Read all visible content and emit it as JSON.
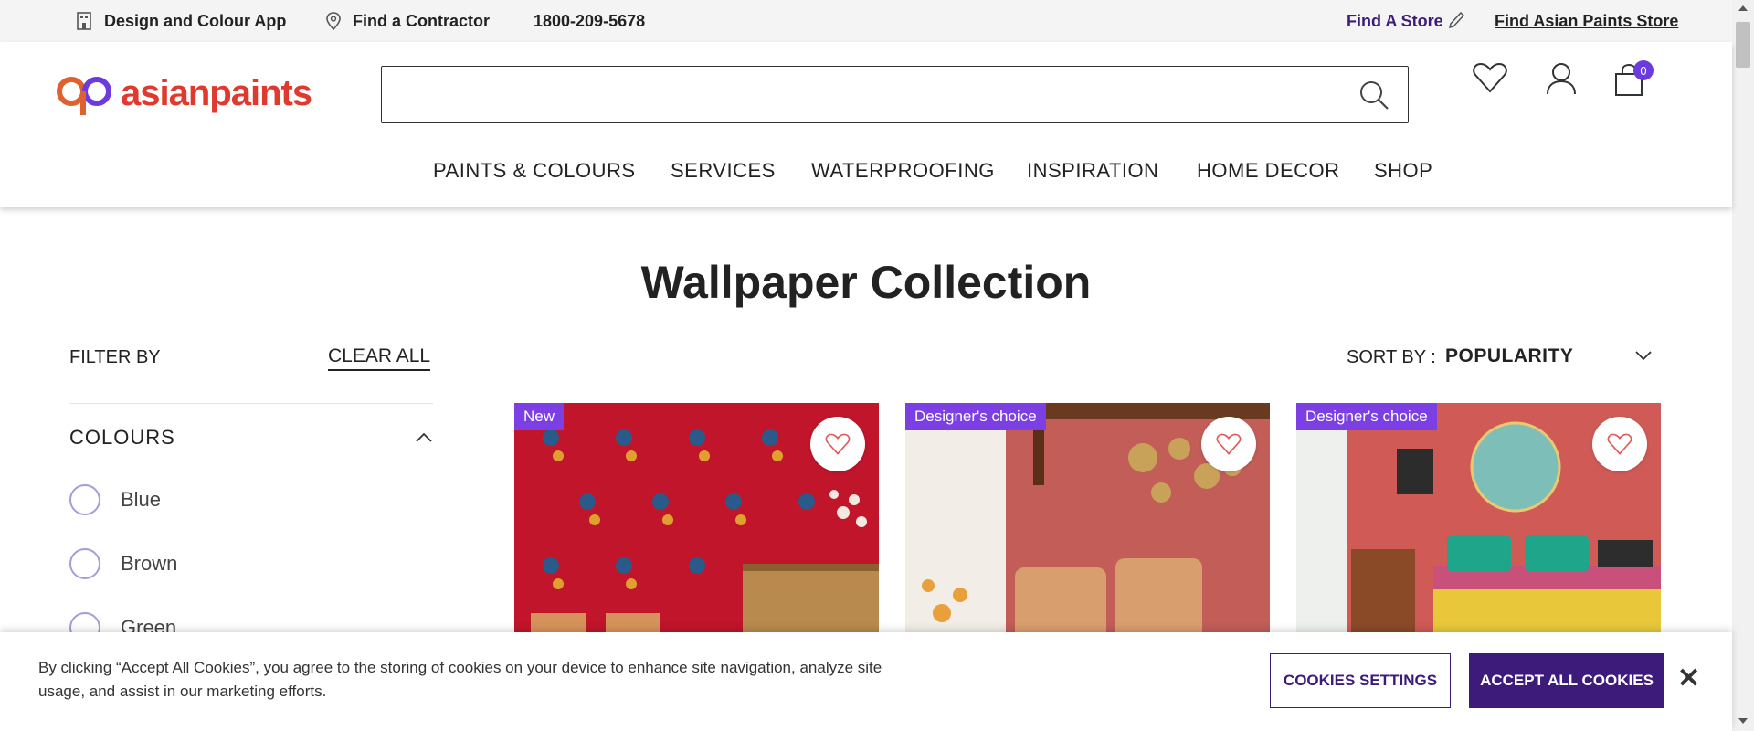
{
  "topbar": {
    "design_app": "Design and Colour App",
    "find_contractor": "Find a Contractor",
    "phone": "1800-209-5678",
    "find_store": "Find A Store",
    "find_asian_store": "Find Asian Paints Store"
  },
  "header": {
    "logo_text": "asianpaints",
    "search_placeholder": "",
    "cart_count": "0"
  },
  "nav": [
    {
      "label": "PAINTS & COLOURS"
    },
    {
      "label": "SERVICES"
    },
    {
      "label": "WATERPROOFING"
    },
    {
      "label": "INSPIRATION"
    },
    {
      "label": "HOME DECOR"
    },
    {
      "label": "SHOP"
    }
  ],
  "page": {
    "title": "Wallpaper Collection"
  },
  "filter": {
    "label": "FILTER BY",
    "clear_all": "CLEAR ALL",
    "section_title": "COLOURS",
    "options": [
      "Blue",
      "Brown",
      "Green"
    ]
  },
  "sort": {
    "label": "SORT BY :",
    "value": "POPULARITY"
  },
  "products": [
    {
      "tag": "New"
    },
    {
      "tag": "Designer's choice"
    },
    {
      "tag": "Designer's choice"
    }
  ],
  "cookie": {
    "text": "By clicking “Accept All Cookies”, you agree to the storing of cookies on your device to enhance site navigation, analyze site usage, and assist in our marketing efforts.",
    "settings_label": "COOKIES SETTINGS",
    "accept_label": "ACCEPT ALL COOKIES",
    "close_label": "✕"
  },
  "colors": {
    "brand_purple": "#3d1b7a",
    "tag_purple": "#7b3fe4",
    "logo_red": "#e03a2f"
  }
}
